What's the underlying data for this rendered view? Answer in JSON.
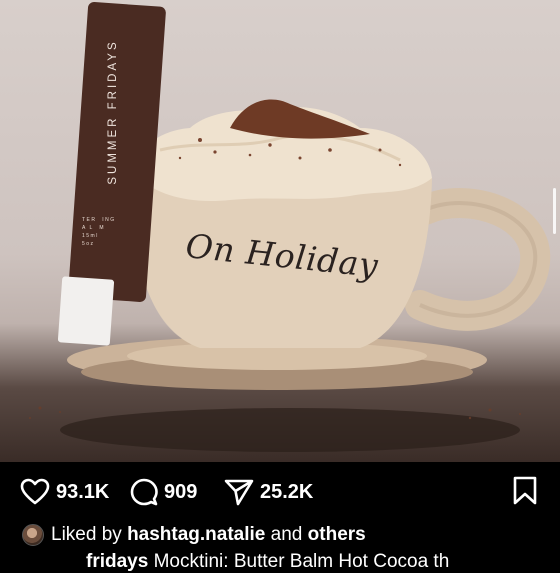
{
  "post": {
    "product_brand": "SUMMER FRIDAYS",
    "product_small_text": "TER  ING\nA L  M\n15ml\n5oz",
    "mug_text": "On Holiday"
  },
  "actions": {
    "likes": "93.1K",
    "comments": "909",
    "shares": "25.2K",
    "like_icon": "heart-icon",
    "comment_icon": "speech-bubble-icon",
    "share_icon": "paper-plane-icon",
    "save_icon": "bookmark-icon"
  },
  "liked_by": {
    "prefix": "Liked by",
    "user": "hashtag.natalie",
    "middle": "and",
    "others": "others"
  },
  "caption": {
    "username": "fridays",
    "text": "Mocktini: Butter Balm Hot Cocoa th"
  },
  "colors": {
    "background": "#000000",
    "tube": "#4a2b22",
    "cup": "#d9c7b0"
  }
}
